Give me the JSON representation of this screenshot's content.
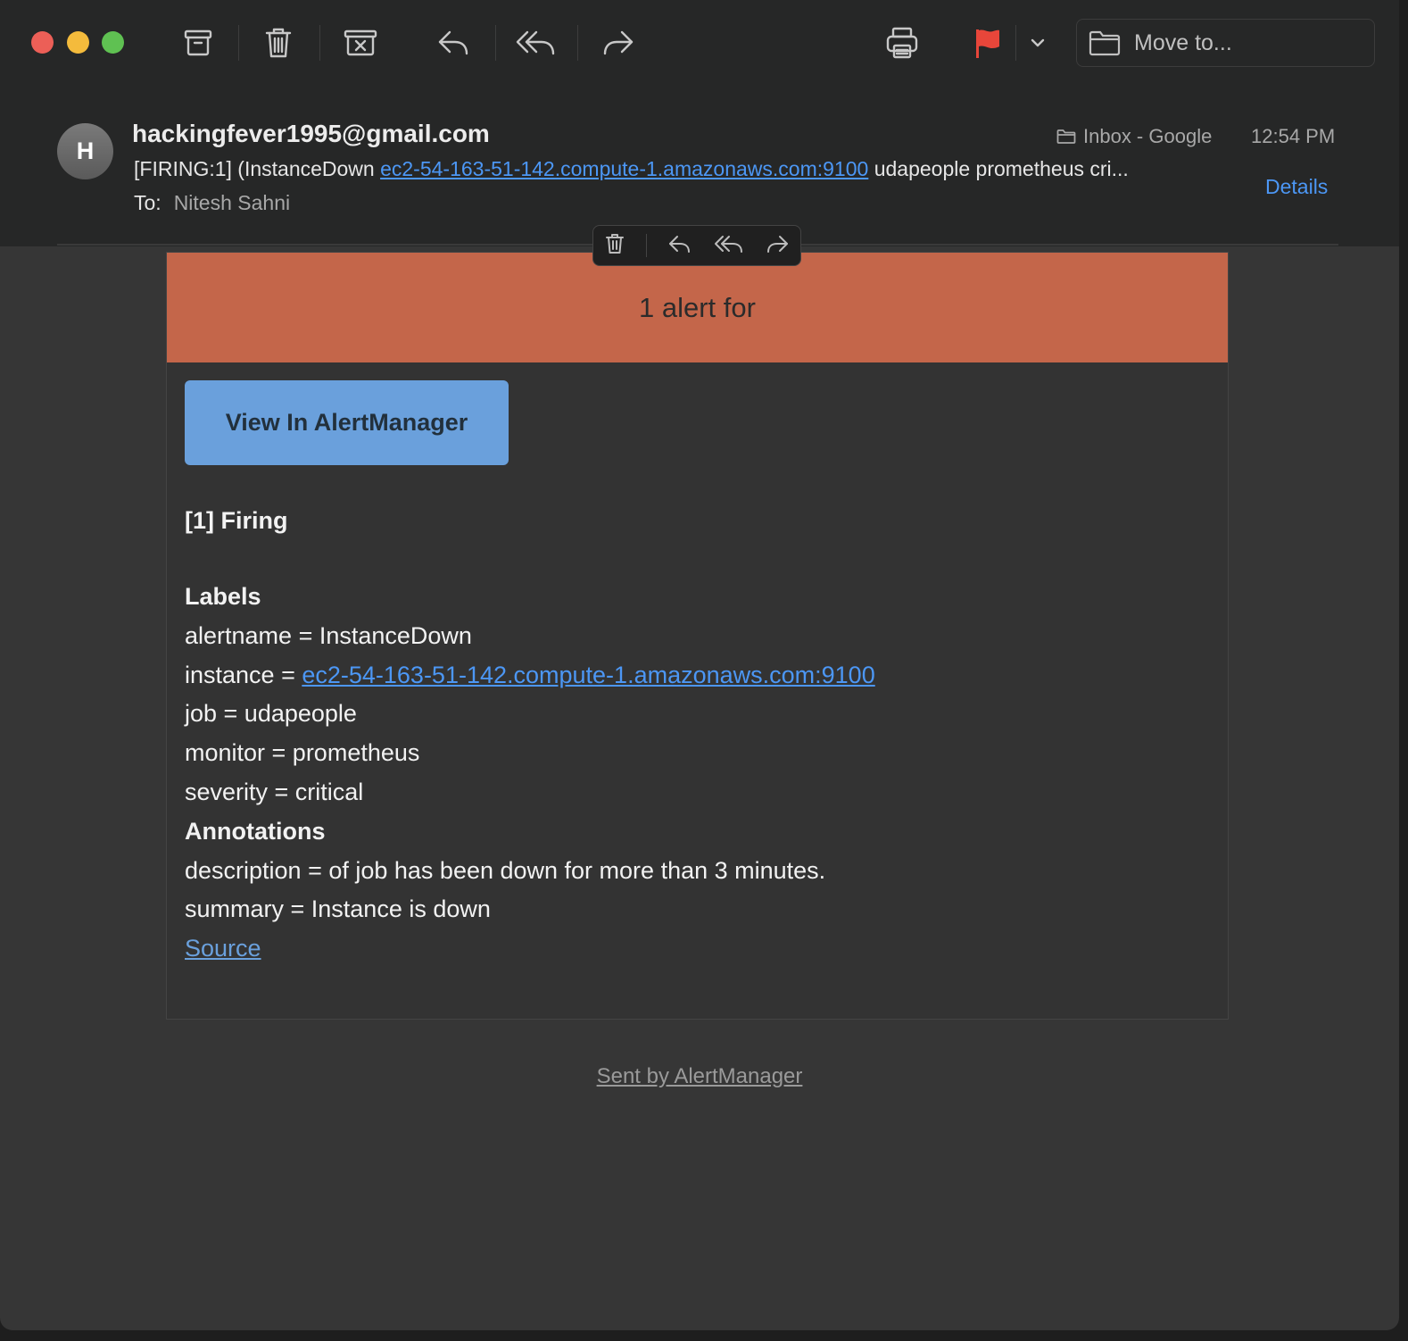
{
  "toolbar": {
    "move_to_label": "Move to...",
    "flag_color": "#e8463a"
  },
  "header": {
    "avatar_letter": "H",
    "sender": "hackingfever1995@gmail.com",
    "subject_prefix": "[FIRING:1]  (InstanceDown ",
    "subject_link": "ec2-54-163-51-142.compute-1.amazonaws.com:9100",
    "subject_suffix": " udapeople prometheus cri...",
    "to_label": "To:",
    "to_name": "Nitesh Sahni",
    "mailbox": "Inbox - Google",
    "time": "12:54 PM",
    "details_label": "Details"
  },
  "email": {
    "banner_title": "1 alert for",
    "button_label": "View In AlertManager",
    "firing_heading": "[1] Firing",
    "labels_heading": "Labels",
    "label_alertname": "alertname = InstanceDown",
    "label_instance_prefix": "instance = ",
    "label_instance_link": "ec2-54-163-51-142.compute-1.amazonaws.com:9100",
    "label_job": "job = udapeople",
    "label_monitor": "monitor = prometheus",
    "label_severity": "severity = critical",
    "annotations_heading": "Annotations",
    "annotation_description": "description = of job has been down for more than 3 minutes.",
    "annotation_summary": "summary = Instance is down",
    "source_link": "Source",
    "banner_color": "#c4664a",
    "button_color": "#6aa0dc"
  },
  "footer": {
    "sent_by": "Sent by AlertManager"
  }
}
